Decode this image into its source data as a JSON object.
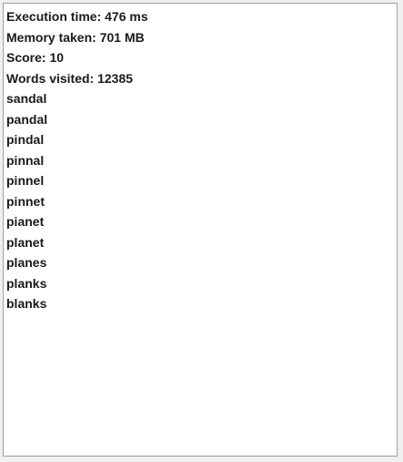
{
  "output": {
    "stats": {
      "execution_time": "Execution time: 476 ms",
      "memory_taken": "Memory taken: 701 MB",
      "score": "Score: 10",
      "words_visited": "Words visited: 12385"
    },
    "words": [
      "sandal",
      "pandal",
      "pindal",
      "pinnal",
      "pinnel",
      "pinnet",
      "pianet",
      "planet",
      "planes",
      "planks",
      "blanks"
    ]
  }
}
